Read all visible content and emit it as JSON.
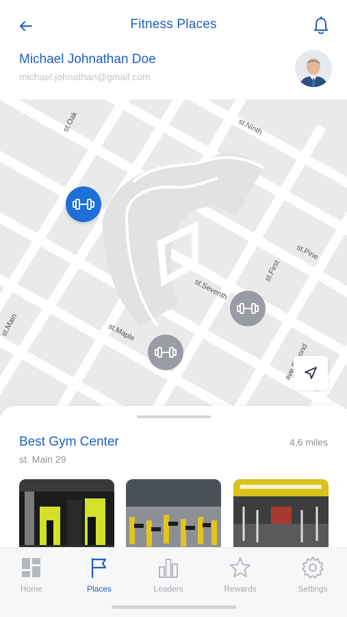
{
  "header": {
    "title": "Fitness Places",
    "back_icon": "arrow-left-icon",
    "bell_icon": "bell-icon"
  },
  "user": {
    "name": "Michael Johnathan Doe",
    "email": "michael.johnathan@gmail.com"
  },
  "map": {
    "streets": [
      "st.Oak",
      "st.Ninth",
      "st.Pine",
      "st.First",
      "st.Seventh",
      "st.Maple",
      "st.Main",
      "ave.Second"
    ],
    "pin_icon": "dumbbell-icon",
    "locate_icon": "navigation-arrow-icon"
  },
  "place": {
    "name": "Best Gym Center",
    "address": "st. Main 29",
    "distance": "4,6 miles"
  },
  "tabs": [
    {
      "label": "Home",
      "icon": "dashboard-icon",
      "active": false
    },
    {
      "label": "Places",
      "icon": "flag-icon",
      "active": true
    },
    {
      "label": "Leaders",
      "icon": "bar-chart-icon",
      "active": false
    },
    {
      "label": "Rewards",
      "icon": "star-icon",
      "active": false
    },
    {
      "label": "Settings",
      "icon": "gear-icon",
      "active": false
    }
  ],
  "colors": {
    "accent": "#1f5fbf",
    "pin_active": "#1f6fd8",
    "pin_inactive": "#9a9ca3",
    "muted": "#8d9197"
  }
}
